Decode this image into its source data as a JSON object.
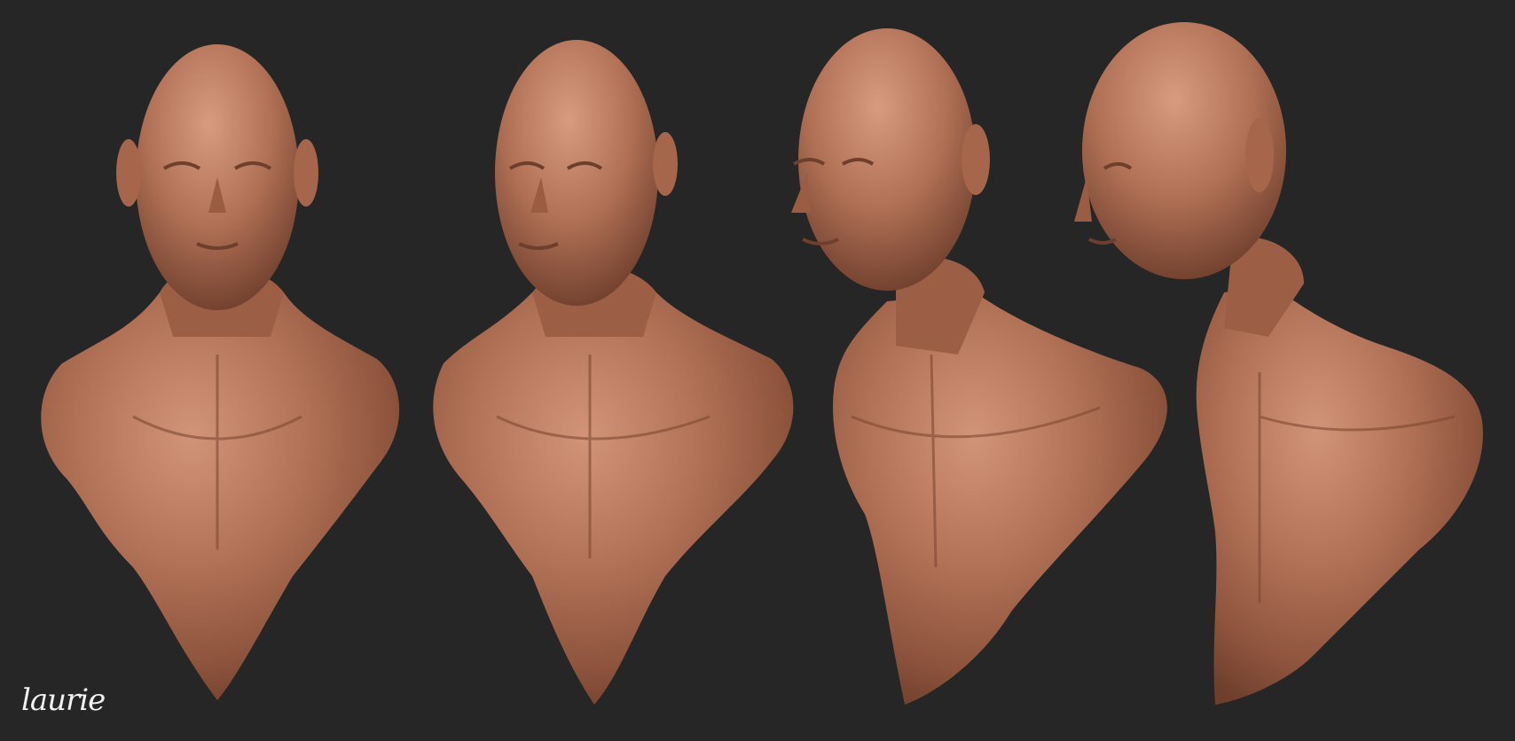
{
  "colors": {
    "background": "#262626",
    "clay_light": "#c98a6c",
    "clay_mid": "#a86a4e",
    "clay_dark": "#6e3f2c",
    "signature": "#f2f2f2"
  },
  "busts": [
    {
      "view": "front"
    },
    {
      "view": "three-quarter-left"
    },
    {
      "view": "three-quarter-profile"
    },
    {
      "view": "profile-left"
    }
  ],
  "signature": "laurie"
}
